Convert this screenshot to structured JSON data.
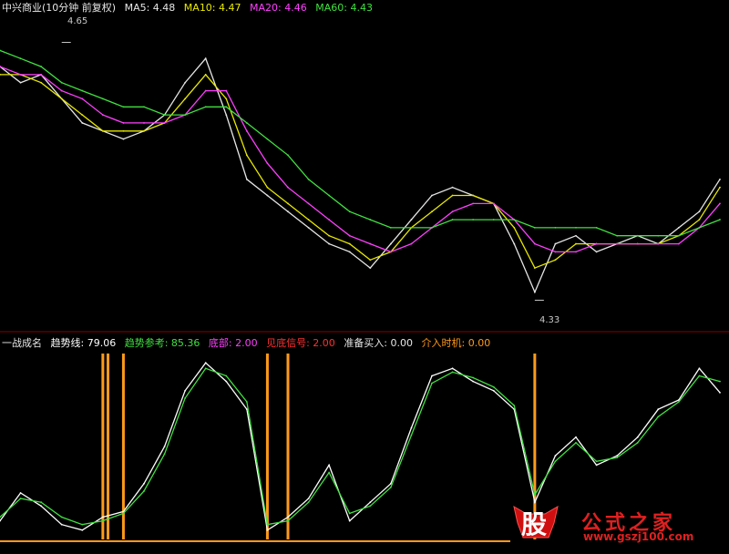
{
  "header_top": {
    "stock": "中兴商业(10分钟 前复权)",
    "items": [
      {
        "label": "MA5: 4.48",
        "color": "#e6e6e6"
      },
      {
        "label": "MA10: 4.47",
        "color": "#e8e800"
      },
      {
        "label": "MA20: 4.46",
        "color": "#ff40ff"
      },
      {
        "label": "MA60: 4.43",
        "color": "#40e040"
      }
    ]
  },
  "header_bottom": {
    "items": [
      {
        "label": "一战成名",
        "color": "#e6e6e6"
      },
      {
        "label": "趋势线: 79.06",
        "color": "#ffffff"
      },
      {
        "label": "趋势参考: 85.36",
        "color": "#40e040"
      },
      {
        "label": "底部: 2.00",
        "color": "#ff40ff"
      },
      {
        "label": "见底信号: 2.00",
        "color": "#ff3030"
      },
      {
        "label": "准备买入: 0.00",
        "color": "#e6e6e6"
      },
      {
        "label": "介入时机: 0.00",
        "color": "#ff9a1a"
      }
    ]
  },
  "price_labels": {
    "high": "4.65",
    "low": "4.33"
  },
  "logo": {
    "glyph": "股",
    "text": "公式之家",
    "url": "www.gszj100.com"
  },
  "chart_data": [
    {
      "type": "line",
      "title": "中兴商业(10分钟 前复权)",
      "ylim": [
        4.3,
        4.68
      ],
      "x": [
        0,
        4,
        8,
        12,
        16,
        20,
        24,
        28,
        32,
        36,
        40,
        44,
        48,
        52,
        56,
        60,
        64,
        68,
        72,
        76,
        80,
        84,
        88,
        92,
        96,
        100,
        104,
        108,
        112,
        116,
        120,
        124,
        128,
        132,
        136,
        140
      ],
      "series": [
        {
          "name": "MA5",
          "color": "#e6e6e6",
          "values": [
            4.62,
            4.6,
            4.61,
            4.58,
            4.55,
            4.54,
            4.53,
            4.54,
            4.56,
            4.6,
            4.63,
            4.56,
            4.48,
            4.46,
            4.44,
            4.42,
            4.4,
            4.39,
            4.37,
            4.4,
            4.43,
            4.46,
            4.47,
            4.46,
            4.45,
            4.4,
            4.34,
            4.4,
            4.41,
            4.39,
            4.4,
            4.41,
            4.4,
            4.42,
            4.44,
            4.48
          ]
        },
        {
          "name": "MA10",
          "color": "#e8e800",
          "values": [
            4.61,
            4.61,
            4.6,
            4.58,
            4.56,
            4.54,
            4.54,
            4.54,
            4.55,
            4.58,
            4.61,
            4.58,
            4.51,
            4.47,
            4.45,
            4.43,
            4.41,
            4.4,
            4.38,
            4.39,
            4.42,
            4.44,
            4.46,
            4.46,
            4.45,
            4.42,
            4.37,
            4.38,
            4.4,
            4.4,
            4.4,
            4.4,
            4.4,
            4.41,
            4.43,
            4.47
          ]
        },
        {
          "name": "MA20",
          "color": "#ff40ff",
          "values": [
            4.62,
            4.61,
            4.61,
            4.59,
            4.58,
            4.56,
            4.55,
            4.55,
            4.55,
            4.56,
            4.59,
            4.59,
            4.54,
            4.5,
            4.47,
            4.45,
            4.43,
            4.41,
            4.4,
            4.39,
            4.4,
            4.42,
            4.44,
            4.45,
            4.45,
            4.43,
            4.4,
            4.39,
            4.39,
            4.4,
            4.4,
            4.4,
            4.4,
            4.4,
            4.42,
            4.45
          ]
        },
        {
          "name": "MA60",
          "color": "#40e040",
          "values": [
            4.64,
            4.63,
            4.62,
            4.6,
            4.59,
            4.58,
            4.57,
            4.57,
            4.56,
            4.56,
            4.57,
            4.57,
            4.55,
            4.53,
            4.51,
            4.48,
            4.46,
            4.44,
            4.43,
            4.42,
            4.42,
            4.42,
            4.43,
            4.43,
            4.43,
            4.43,
            4.42,
            4.42,
            4.42,
            4.42,
            4.41,
            4.41,
            4.41,
            4.41,
            4.42,
            4.43
          ]
        }
      ],
      "annotations": [
        {
          "x": 12,
          "value": 4.65
        },
        {
          "x": 104,
          "value": 4.33
        }
      ]
    },
    {
      "type": "line",
      "title": "一战成名",
      "ylim": [
        0,
        100
      ],
      "x": [
        0,
        4,
        8,
        12,
        16,
        20,
        24,
        28,
        32,
        36,
        40,
        44,
        48,
        52,
        56,
        60,
        64,
        68,
        72,
        76,
        80,
        84,
        88,
        92,
        96,
        100,
        104,
        108,
        112,
        116,
        120,
        124,
        128,
        132,
        136,
        140
      ],
      "series": [
        {
          "name": "趋势线",
          "color": "#ffffff",
          "values": [
            10,
            25,
            18,
            8,
            5,
            12,
            15,
            30,
            50,
            80,
            95,
            85,
            70,
            5,
            12,
            22,
            40,
            10,
            20,
            30,
            60,
            88,
            92,
            85,
            80,
            70,
            20,
            45,
            55,
            40,
            45,
            55,
            70,
            75,
            92,
            79
          ]
        },
        {
          "name": "趋势参考",
          "color": "#40e040",
          "values": [
            12,
            22,
            20,
            12,
            8,
            10,
            14,
            26,
            46,
            76,
            92,
            88,
            74,
            8,
            10,
            20,
            36,
            14,
            18,
            28,
            56,
            84,
            90,
            87,
            82,
            72,
            24,
            42,
            52,
            42,
            44,
            52,
            66,
            74,
            88,
            85
          ]
        }
      ],
      "signals": [
        {
          "name": "介入时机",
          "color": "#ff9a1a",
          "x": [
            20,
            21,
            24,
            52,
            56,
            104
          ]
        }
      ]
    }
  ]
}
